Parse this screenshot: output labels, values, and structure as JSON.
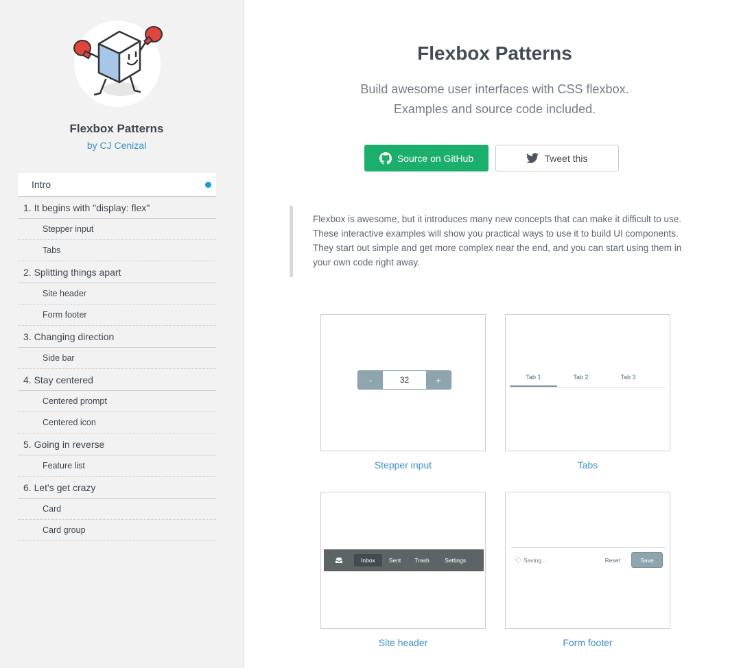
{
  "colors": {
    "accent_link": "#3b8fc4",
    "github_green": "#1ab06c",
    "active_dot": "#1a9ae0",
    "demo_slate": "#8fa5ae"
  },
  "sidebar": {
    "logo_icon": "boxing-cube-mascot-icon",
    "title": "Flexbox Patterns",
    "author": "by CJ Cenizal",
    "nav": [
      {
        "label": "Intro",
        "type": "active"
      },
      {
        "label": "1. It begins with \"display: flex\"",
        "type": "section"
      },
      {
        "label": "Stepper input",
        "type": "sub"
      },
      {
        "label": "Tabs",
        "type": "sub"
      },
      {
        "label": "2. Splitting things apart",
        "type": "section"
      },
      {
        "label": "Site header",
        "type": "sub"
      },
      {
        "label": "Form footer",
        "type": "sub"
      },
      {
        "label": "3. Changing direction",
        "type": "section"
      },
      {
        "label": "Side bar",
        "type": "sub"
      },
      {
        "label": "4. Stay centered",
        "type": "section"
      },
      {
        "label": "Centered prompt",
        "type": "sub"
      },
      {
        "label": "Centered icon",
        "type": "sub"
      },
      {
        "label": "5. Going in reverse",
        "type": "section"
      },
      {
        "label": "Feature list",
        "type": "sub"
      },
      {
        "label": "6. Let's get crazy",
        "type": "section"
      },
      {
        "label": "Card",
        "type": "sub"
      },
      {
        "label": "Card group",
        "type": "sub"
      }
    ]
  },
  "main": {
    "title": "Flexbox Patterns",
    "subtitle_line1": "Build awesome user interfaces with CSS flexbox.",
    "subtitle_line2": "Examples and source code included.",
    "github_button": "Source on GitHub",
    "tweet_button": "Tweet this",
    "intro": "Flexbox is awesome, but it introduces many new concepts that can make it difficult to use. These interactive examples will show you practical ways to use it to build UI components. They start out simple and get more complex near the end, and you can start using them in your own code right away.",
    "cards": {
      "stepper": {
        "label": "Stepper input",
        "minus": "-",
        "value": "32",
        "plus": "+"
      },
      "tabs": {
        "label": "Tabs",
        "items": [
          "Tab 1",
          "Tab 2",
          "Tab 3"
        ],
        "active_index": 0
      },
      "site_header": {
        "label": "Site header",
        "items": [
          "Inbox",
          "Sent",
          "Trash"
        ],
        "settings": "Settings",
        "active_index": 0
      },
      "form_footer": {
        "label": "Form footer",
        "saving": "Saving...",
        "reset": "Reset",
        "save": "Save"
      }
    }
  }
}
